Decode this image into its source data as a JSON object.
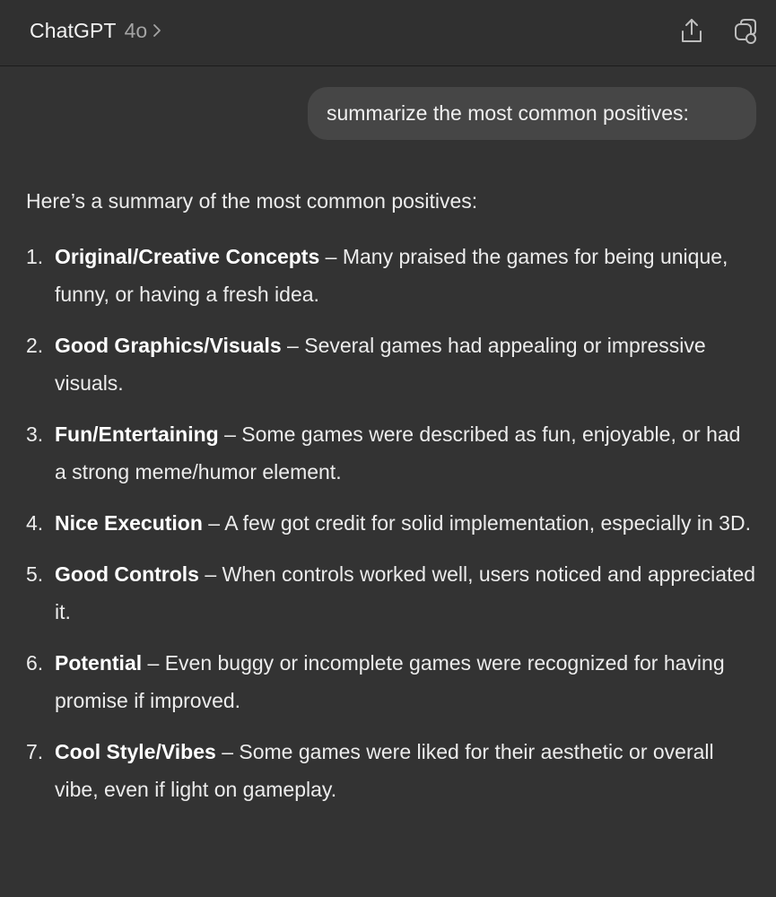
{
  "header": {
    "app_name": "ChatGPT",
    "model": "4o",
    "icons": {
      "chevron": "chevron-right-icon",
      "share": "share-icon",
      "new_chat": "new-chat-icon"
    }
  },
  "conversation": {
    "user_message": "summarize the most common positives:",
    "assistant": {
      "intro": "Here’s a summary of the most common positives:",
      "items": [
        {
          "num": "1.",
          "title": "Original/Creative Concepts",
          "text": " – Many praised the games for being unique, funny, or having a fresh idea."
        },
        {
          "num": "2.",
          "title": "Good Graphics/Visuals",
          "text": " – Several games had appealing or impressive visuals."
        },
        {
          "num": "3.",
          "title": "Fun/Entertaining",
          "text": " – Some games were described as fun, enjoyable, or had a strong meme/humor element."
        },
        {
          "num": "4.",
          "title": "Nice Execution",
          "text": " – A few got credit for solid implementation, especially in 3D."
        },
        {
          "num": "5.",
          "title": "Good Controls",
          "text": " – When controls worked well, users noticed and appreciated it."
        },
        {
          "num": "6.",
          "title": "Potential",
          "text": " – Even buggy or incomplete games were recognized for having promise if improved."
        },
        {
          "num": "7.",
          "title": "Cool Style/Vibes",
          "text": " – Some games were liked for their aesthetic or overall vibe, even if light on gameplay."
        }
      ]
    }
  },
  "colors": {
    "background": "#333333",
    "header_background": "#303030",
    "user_bubble": "#464646",
    "text": "#ececec",
    "muted_text": "#a4a4a4"
  }
}
